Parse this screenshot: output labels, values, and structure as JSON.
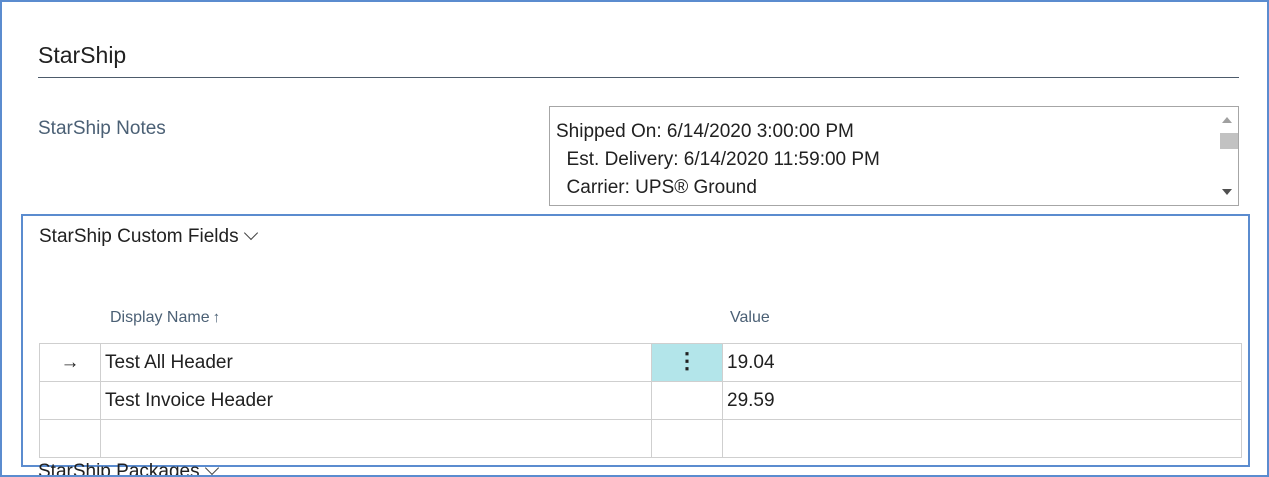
{
  "section": {
    "title": "StarShip"
  },
  "notes": {
    "label": "StarShip Notes",
    "text": "Shipped On: 6/14/2020 3:00:00 PM\n  Est. Delivery: 6/14/2020 11:59:00 PM\n  Carrier: UPS® Ground"
  },
  "custom_fields": {
    "title": "StarShip Custom Fields",
    "columns": {
      "display_name": "Display Name",
      "sort_icon": "↑",
      "value": "Value"
    },
    "rows": [
      {
        "indicator": "→",
        "name": "Test All Header",
        "menu": "⋮",
        "value": "19.04"
      },
      {
        "indicator": "",
        "name": "Test Invoice Header",
        "menu": "",
        "value": "29.59"
      },
      {
        "indicator": "",
        "name": "",
        "menu": "",
        "value": ""
      }
    ]
  },
  "packages": {
    "title": "StarShip Packages"
  },
  "colors": {
    "accent_border": "#5b8ccf",
    "selected_cell": "#b3e5ea",
    "label_text": "#4b6075"
  }
}
